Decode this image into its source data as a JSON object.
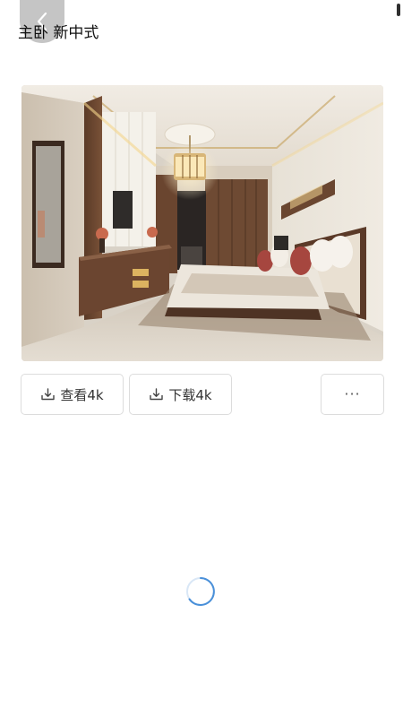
{
  "header": {
    "title": "主卧  新中式"
  },
  "actions": {
    "view_label": "查看4k",
    "download_label": "下载4k",
    "more_label": "···"
  },
  "icons": {
    "back": "chevron-left-icon",
    "view": "download-tray-icon",
    "download": "download-tray-icon",
    "loader": "loading-spinner-icon"
  },
  "colors": {
    "spinner": "#4a90d9",
    "button_border": "#dcdcdc"
  }
}
